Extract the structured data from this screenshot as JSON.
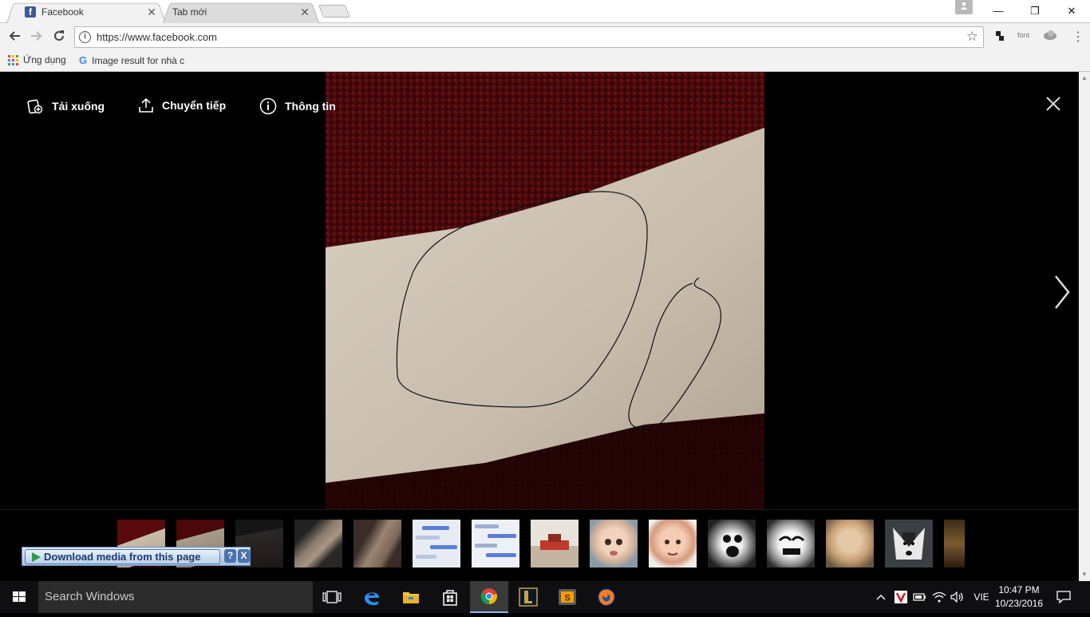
{
  "browser": {
    "tabs": [
      {
        "title": "Facebook",
        "favicon": "f",
        "close": "✕",
        "active": true
      },
      {
        "title": "Tab mới",
        "close": "✕",
        "active": false
      }
    ],
    "window_controls": {
      "minimize": "—",
      "restore": "❐",
      "close": "✕"
    },
    "address": {
      "url": "https://www.facebook.com"
    },
    "extensions": {
      "font": "font"
    },
    "bookmarks": [
      {
        "label": "Ứng dụng",
        "icon": "apps-grid-icon"
      },
      {
        "label": "Image result for nhà c",
        "icon": "google-icon"
      }
    ]
  },
  "viewer": {
    "actions": {
      "download": "Tải xuống",
      "forward": "Chuyển tiếp",
      "info": "Thông tin"
    },
    "thumbnail_count": 15
  },
  "download_bar": {
    "label": "Download media from this page",
    "help": "?",
    "close": "X"
  },
  "taskbar": {
    "search_placeholder": "Search Windows",
    "language": "VIE",
    "time": "10:47 PM",
    "date": "10/23/2016"
  },
  "colors": {
    "facebook": "#3b5998",
    "taskbar": "#0f0f12",
    "chrome_toolbar": "#f2f2f2"
  }
}
